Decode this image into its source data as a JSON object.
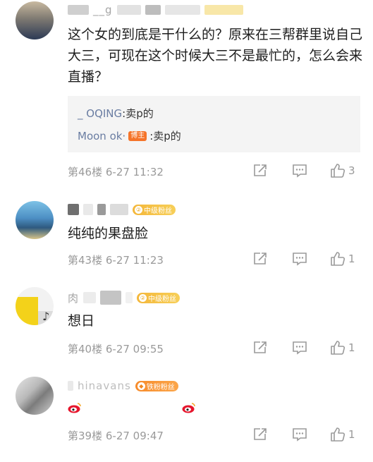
{
  "comments": [
    {
      "name": "__g",
      "badge": "",
      "text": "这个女的到底是干什么的？原来在三帮群里说自己大三，可现在这个时候大三不是最忙的，怎么会来直播？",
      "replies": [
        {
          "name": "_        OQING",
          "sep": ": ",
          "text": "卖p的"
        },
        {
          "name": "Moon    ok·",
          "tag": "博主",
          "sep": ": ",
          "text": "卖p的"
        }
      ],
      "floor": "第46楼",
      "time": "6-27 11:32",
      "likes": "3"
    },
    {
      "name": "",
      "badge": "中级粉丝",
      "text": "纯纯的果盘脸",
      "floor": "第43楼",
      "time": "6-27 11:23",
      "likes": "1"
    },
    {
      "name": "肉",
      "badge": "中级粉丝",
      "text": "想日",
      "floor": "第40楼",
      "time": "6-27 09:55",
      "likes": "1"
    },
    {
      "name": "hinavans",
      "badge": "铁粉粉丝",
      "text": "",
      "floor": "第39楼",
      "time": "6-27 09:47",
      "likes": "1"
    }
  ],
  "icons": {
    "share": "share-icon",
    "reply": "comment-icon",
    "like": "thumb-up-icon",
    "weibo": "weibo-emoji-icon"
  },
  "colors": {
    "reply_name": "#6a7da2",
    "meta": "#9a9a9a",
    "badge_gold": "#f4b73a",
    "badge_orange": "#f78b2a",
    "host_tag": "#f5742a"
  }
}
